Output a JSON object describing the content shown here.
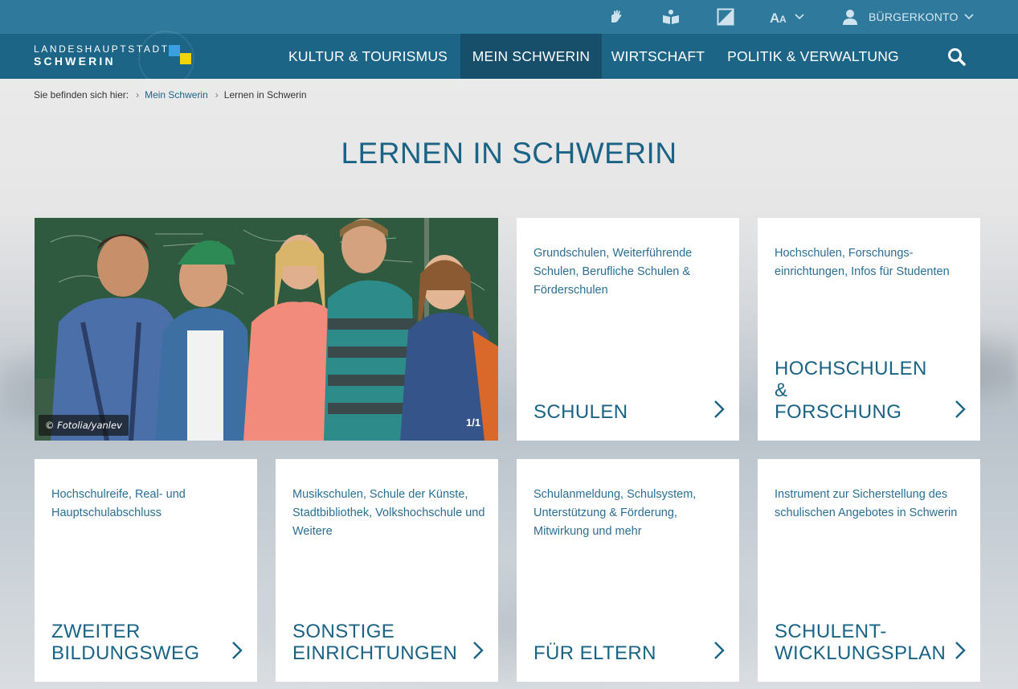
{
  "topbar": {
    "icons": [
      "sign-language-icon",
      "easy-read-icon",
      "contrast-icon",
      "font-size-icon"
    ],
    "account_label": "BÜRGERKONTO",
    "colors": {
      "topbar": "#2f7a9c",
      "navbar": "#1d6587",
      "active": "#174f6b",
      "accent": "#1a6385"
    }
  },
  "logo": {
    "line1": "LANDESHAUPTSTADT",
    "line2": "SCHWERIN"
  },
  "nav": {
    "items": [
      {
        "label": "KULTUR & TOURISMUS"
      },
      {
        "label": "MEIN SCHWERIN"
      },
      {
        "label": "WIRTSCHAFT"
      },
      {
        "label": "POLITIK & VERWALTUNG"
      }
    ],
    "active_item": "MEIN SCHWERIN"
  },
  "breadcrumb": {
    "prefix": "Sie befinden sich hier:",
    "items": [
      "Mein Schwerin",
      "Lernen in Schwerin"
    ]
  },
  "page": {
    "title": "LERNEN IN SCHWERIN"
  },
  "hero": {
    "credit": "© Fotolia/yanlev",
    "counter": "1/1"
  },
  "cards": [
    {
      "desc": "Grundschulen, Weiterführende Schulen, Berufliche Schulen & Förderschulen",
      "title": "SCHULEN"
    },
    {
      "desc": "Hochschulen, Forschungs-einrichtungen, Infos für Studenten",
      "title": "HOCHSCHULEN &\nFORSCHUNG"
    },
    {
      "desc": "Hochschulreife, Real- und Hauptschulabschluss",
      "title": "ZWEITER\nBILDUNGSWEG"
    },
    {
      "desc": "Musikschulen, Schule der Künste, Stadtbibliothek, Volkshochschule und Weitere",
      "title": "SONSTIGE\nEINRICHTUNGEN"
    },
    {
      "desc": "Schulanmeldung, Schulsystem, Unterstützung & Förderung, Mitwirkung und mehr",
      "title": "FÜR ELTERN"
    },
    {
      "desc": "Instrument zur Sicherstellung des schulischen Angebotes in Schwerin",
      "title": "SCHULENT-\nWICKLUNGSPLAN"
    }
  ]
}
